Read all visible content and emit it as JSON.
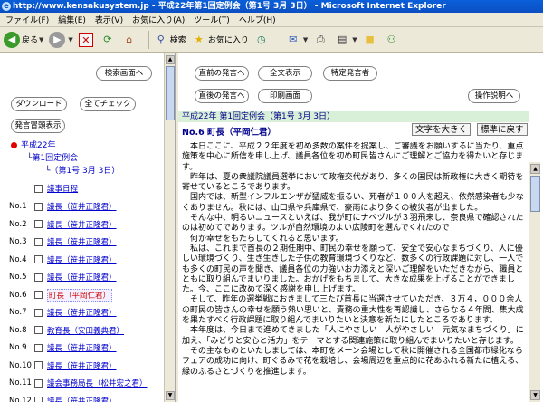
{
  "window": {
    "title": "http://www.kensakusystem.jp - 平成22年第1回定例会（第1号 3月 3日） - Microsoft Internet Explorer"
  },
  "menu": [
    "ファイル(F)",
    "編集(E)",
    "表示(V)",
    "お気に入り(A)",
    "ツール(T)",
    "ヘルプ(H)"
  ],
  "toolbar": {
    "back": "戻る",
    "search": "検索",
    "favorites": "お気に入り"
  },
  "left": {
    "search_screen": "検索画面へ",
    "download": "ダウンロード",
    "check_all": "全てチェック",
    "speaker_list": "発言冒頭表示",
    "tree": {
      "year": "平成22年",
      "session": "第1回定例会",
      "meeting": "（第1号 3月 3日）"
    },
    "schedule": "議事日程",
    "speakers": [
      {
        "no": "No.1",
        "name": "議長（笹井正隆君）"
      },
      {
        "no": "No.2",
        "name": "議長（笹井正隆君）"
      },
      {
        "no": "No.3",
        "name": "議長（笹井正隆君）"
      },
      {
        "no": "No.4",
        "name": "議長（笹井正隆君）"
      },
      {
        "no": "No.5",
        "name": "議長（笹井正隆君）"
      },
      {
        "no": "No.6",
        "name": "町長（平岡仁君）"
      },
      {
        "no": "No.7",
        "name": "議長（笹井正隆君）"
      },
      {
        "no": "No.8",
        "name": "教育長（安田義典君）"
      },
      {
        "no": "No.9",
        "name": "議長（笹井正隆君）"
      },
      {
        "no": "No.10",
        "name": "議長（笹井正隆君）"
      },
      {
        "no": "No.11",
        "name": "議会事務局長（松井宏之君）"
      },
      {
        "no": "No.12",
        "name": "議長（笹井正隆君）"
      }
    ]
  },
  "right": {
    "prev_speaker": "直前の発言へ",
    "full_text": "全文表示",
    "specific_speaker": "特定発言者",
    "next_speaker": "直後の発言へ",
    "print_screen": "印刷画面",
    "help": "操作説明へ",
    "session_title": "平成22年 第1回定例会（第1号 3月 3日）",
    "speaker_heading": "No.6 町長（平岡仁君）",
    "enlarge_text": "文字を大きく",
    "standard": "標準に戻す",
    "paragraphs": [
      "本日ここに、平成２２年度を初め多数の案件を提案し、ご審議をお願いするに当たり、重点施策を中心に所信を申し上げ、議員各位を初め町民皆さんにご理解とご協力を得たいと存じます。",
      "昨年は、夏の衆議院議員選挙において政権交代があり、多くの国民は新政権に大きく期待を寄せているところであります。",
      "国内では、新型インフルエンザが猛威を振るい、死者が１００人を超え、依然感染者も少なくありません。秋には、山口県や兵庫県で、豪雨により多くの被災者が出ました。",
      "そんな中、明るいニュースといえば、我が町にナベヅルが３羽飛来し、奈良県で確認されたのは初めてであります。ツルが自然環境のよい広陵町を選んでくれたので",
      "何か幸せをもたらしてくれると思います。",
      "私は、これまで首長の２期任期中、町民の幸せを願って、安全で安心なまちづくり、人に優しい環境づくり、生き生きした子供の教育環境づくりなど、数多くの行政課題に対し、一人でも多くの町民の声を聞き、議員各位の力強いお力添えと深いご理解をいただきながら、職員とともに取り組んでまいりました。おかげをもちまして、大きな成果を上げることができました。今、ここに改めて深く感謝を申し上げます。",
      "そして、昨年の選挙戦におきまして三たび首長に当選させていただき、３万４，０００余人の町民の皆さんの幸せを願う熱い思いと、責務の重大性を再認識し、さらなる４年間、集大成を果たすべく行政課題に取り組んでまいりたいと決意を新たにしたところであります。",
      "本年度は、今日まで進めてきました「人にやさしい　人がやさしい　元気なまちづくり」に加え、「みどりと安心と活力」をテーマとする関連施策に取り組んでまいりたいと存じます。",
      "その主なものといたしましては、本町をメーン会場として秋に開催される全国都市緑化ならフェアの成功に向け、町ぐるみで花を栽培し、会場周辺を重点的に花あふれる新たに植える、緑のふるさとづくりを推進します。"
    ]
  }
}
